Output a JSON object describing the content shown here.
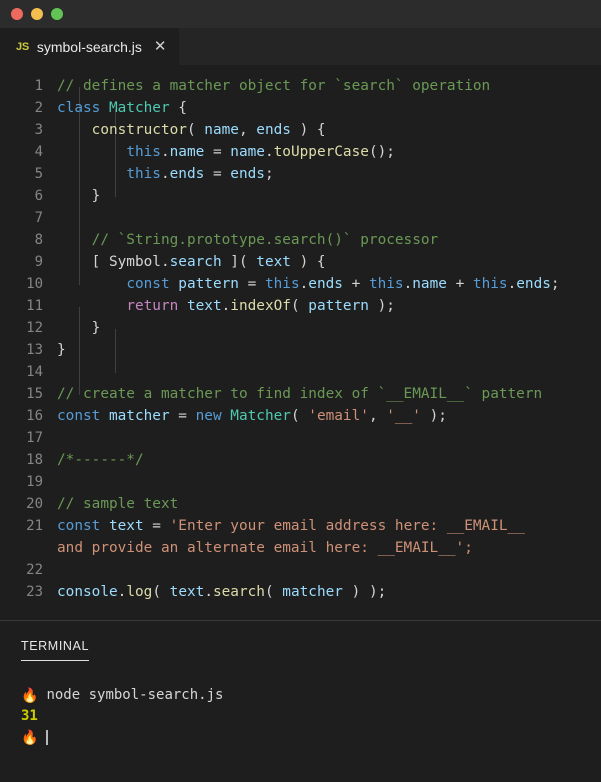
{
  "window": {
    "traffic_lights": [
      "close",
      "minimize",
      "maximize"
    ],
    "colors": {
      "close": "#ed6a5e",
      "minimize": "#f5bf4f",
      "maximize": "#61c454",
      "background": "#1e1e1e",
      "titlebar": "#2c2c2c",
      "tabbar": "#252526",
      "comment": "#6a9955",
      "keyword": "#569cd6",
      "class": "#4ec9b0",
      "function": "#dcdcaa",
      "variable": "#9cdcfe",
      "string": "#ce9178",
      "control": "#c586c0",
      "line_number": "#858585",
      "terminal_output": "#cdcd00"
    }
  },
  "tab": {
    "icon_label": "JS",
    "filename": "symbol-search.js",
    "close_label": "✕"
  },
  "editor": {
    "language": "javascript",
    "first_line_number": 1,
    "last_line_number": 23,
    "lines": [
      {
        "n": "1",
        "tokens": [
          {
            "t": "// defines a matcher object for `search` operation",
            "c": "c-comment"
          }
        ]
      },
      {
        "n": "2",
        "tokens": [
          {
            "t": "class ",
            "c": "c-keyword"
          },
          {
            "t": "Matcher",
            "c": "c-class"
          },
          {
            "t": " {",
            "c": "c-punct"
          }
        ]
      },
      {
        "n": "3",
        "tokens": [
          {
            "t": "    ",
            "c": "c-plain"
          },
          {
            "t": "constructor",
            "c": "c-func"
          },
          {
            "t": "( ",
            "c": "c-punct"
          },
          {
            "t": "name",
            "c": "c-var"
          },
          {
            "t": ", ",
            "c": "c-punct"
          },
          {
            "t": "ends",
            "c": "c-var"
          },
          {
            "t": " ) {",
            "c": "c-punct"
          }
        ]
      },
      {
        "n": "4",
        "tokens": [
          {
            "t": "        ",
            "c": "c-plain"
          },
          {
            "t": "this",
            "c": "c-keyword"
          },
          {
            "t": ".",
            "c": "c-punct"
          },
          {
            "t": "name",
            "c": "c-var"
          },
          {
            "t": " = ",
            "c": "c-punct"
          },
          {
            "t": "name",
            "c": "c-var"
          },
          {
            "t": ".",
            "c": "c-punct"
          },
          {
            "t": "toUpperCase",
            "c": "c-func"
          },
          {
            "t": "();",
            "c": "c-punct"
          }
        ]
      },
      {
        "n": "5",
        "tokens": [
          {
            "t": "        ",
            "c": "c-plain"
          },
          {
            "t": "this",
            "c": "c-keyword"
          },
          {
            "t": ".",
            "c": "c-punct"
          },
          {
            "t": "ends",
            "c": "c-var"
          },
          {
            "t": " = ",
            "c": "c-punct"
          },
          {
            "t": "ends",
            "c": "c-var"
          },
          {
            "t": ";",
            "c": "c-punct"
          }
        ]
      },
      {
        "n": "6",
        "tokens": [
          {
            "t": "    }",
            "c": "c-punct"
          }
        ]
      },
      {
        "n": "7",
        "tokens": []
      },
      {
        "n": "8",
        "tokens": [
          {
            "t": "    ",
            "c": "c-plain"
          },
          {
            "t": "// `String.prototype.search()` processor",
            "c": "c-comment"
          }
        ]
      },
      {
        "n": "9",
        "tokens": [
          {
            "t": "    [ ",
            "c": "c-punct"
          },
          {
            "t": "Symbol",
            "c": "c-plain"
          },
          {
            "t": ".",
            "c": "c-punct"
          },
          {
            "t": "search",
            "c": "c-var"
          },
          {
            "t": " ]( ",
            "c": "c-punct"
          },
          {
            "t": "text",
            "c": "c-var"
          },
          {
            "t": " ) {",
            "c": "c-punct"
          }
        ]
      },
      {
        "n": "10",
        "tokens": [
          {
            "t": "        ",
            "c": "c-plain"
          },
          {
            "t": "const ",
            "c": "c-keyword"
          },
          {
            "t": "pattern",
            "c": "c-var"
          },
          {
            "t": " = ",
            "c": "c-punct"
          },
          {
            "t": "this",
            "c": "c-keyword"
          },
          {
            "t": ".",
            "c": "c-punct"
          },
          {
            "t": "ends",
            "c": "c-var"
          },
          {
            "t": " + ",
            "c": "c-punct"
          },
          {
            "t": "this",
            "c": "c-keyword"
          },
          {
            "t": ".",
            "c": "c-punct"
          },
          {
            "t": "name",
            "c": "c-var"
          },
          {
            "t": " + ",
            "c": "c-punct"
          },
          {
            "t": "this",
            "c": "c-keyword"
          },
          {
            "t": ".",
            "c": "c-punct"
          },
          {
            "t": "ends",
            "c": "c-var"
          },
          {
            "t": ";",
            "c": "c-punct"
          }
        ]
      },
      {
        "n": "11",
        "tokens": [
          {
            "t": "        ",
            "c": "c-plain"
          },
          {
            "t": "return ",
            "c": "c-ctrl"
          },
          {
            "t": "text",
            "c": "c-var"
          },
          {
            "t": ".",
            "c": "c-punct"
          },
          {
            "t": "indexOf",
            "c": "c-func"
          },
          {
            "t": "( ",
            "c": "c-punct"
          },
          {
            "t": "pattern",
            "c": "c-var"
          },
          {
            "t": " );",
            "c": "c-punct"
          }
        ]
      },
      {
        "n": "12",
        "tokens": [
          {
            "t": "    }",
            "c": "c-punct"
          }
        ]
      },
      {
        "n": "13",
        "tokens": [
          {
            "t": "}",
            "c": "c-punct"
          }
        ]
      },
      {
        "n": "14",
        "tokens": []
      },
      {
        "n": "15",
        "tokens": [
          {
            "t": "// create a matcher to find index of `__EMAIL__` pattern",
            "c": "c-comment"
          }
        ]
      },
      {
        "n": "16",
        "tokens": [
          {
            "t": "const ",
            "c": "c-keyword"
          },
          {
            "t": "matcher",
            "c": "c-var"
          },
          {
            "t": " = ",
            "c": "c-punct"
          },
          {
            "t": "new ",
            "c": "c-keyword"
          },
          {
            "t": "Matcher",
            "c": "c-class"
          },
          {
            "t": "( ",
            "c": "c-punct"
          },
          {
            "t": "'email'",
            "c": "c-string"
          },
          {
            "t": ", ",
            "c": "c-punct"
          },
          {
            "t": "'__'",
            "c": "c-string"
          },
          {
            "t": " );",
            "c": "c-punct"
          }
        ]
      },
      {
        "n": "17",
        "tokens": []
      },
      {
        "n": "18",
        "tokens": [
          {
            "t": "/*------*/",
            "c": "c-comment"
          }
        ]
      },
      {
        "n": "19",
        "tokens": []
      },
      {
        "n": "20",
        "tokens": [
          {
            "t": "// sample text",
            "c": "c-comment"
          }
        ]
      },
      {
        "n": "21",
        "tokens": [
          {
            "t": "const ",
            "c": "c-keyword"
          },
          {
            "t": "text",
            "c": "c-var"
          },
          {
            "t": " = ",
            "c": "c-punct"
          },
          {
            "t": "'Enter your email address here: __EMAIL__",
            "c": "c-string"
          }
        ]
      },
      {
        "n": "",
        "tokens": [
          {
            "t": "and provide an alternate email here: __EMAIL__';",
            "c": "c-string"
          }
        ]
      },
      {
        "n": "22",
        "tokens": []
      },
      {
        "n": "23",
        "tokens": [
          {
            "t": "console",
            "c": "c-var"
          },
          {
            "t": ".",
            "c": "c-punct"
          },
          {
            "t": "log",
            "c": "c-func"
          },
          {
            "t": "( ",
            "c": "c-punct"
          },
          {
            "t": "text",
            "c": "c-var"
          },
          {
            "t": ".",
            "c": "c-punct"
          },
          {
            "t": "search",
            "c": "c-func"
          },
          {
            "t": "( ",
            "c": "c-punct"
          },
          {
            "t": "matcher",
            "c": "c-var"
          },
          {
            "t": " ) );",
            "c": "c-punct"
          }
        ]
      }
    ]
  },
  "terminal": {
    "tab_label": "TERMINAL",
    "prompt_icon": "fire-emoji",
    "prompt_glyph": "🔥",
    "lines": [
      {
        "type": "command",
        "prompt": "🔥",
        "text": "node symbol-search.js"
      },
      {
        "type": "output",
        "text": "31"
      },
      {
        "type": "prompt",
        "prompt": "🔥",
        "text": ""
      }
    ]
  }
}
